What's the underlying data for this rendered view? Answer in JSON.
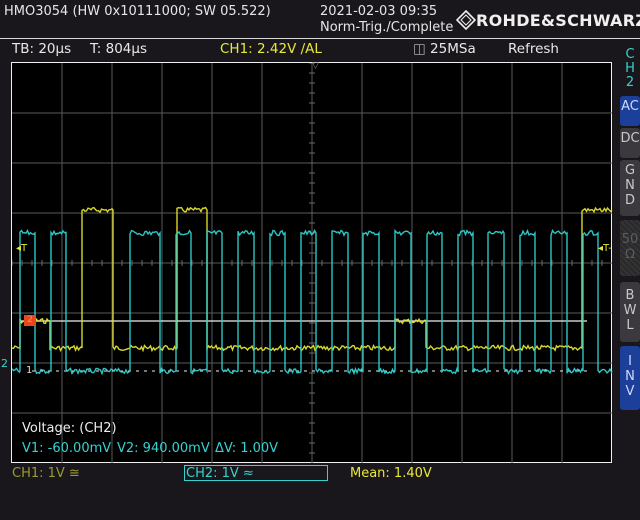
{
  "header": {
    "device": "HMO3054 (HW 0x10111000; SW 05.522)",
    "datetime": "2021-02-03 09:35",
    "trigger_state": "Norm-Trig./Complete",
    "brand": "ROHDE&SCHWARZ"
  },
  "status_bar": {
    "timebase": "TB: 20µs",
    "trigger_time": "T: 804µs",
    "trigger_level": "CH1: 2.42V ∕AL",
    "sample_rate": "25MSa",
    "mode": "Refresh"
  },
  "side_menu": {
    "channel": [
      "C",
      "H",
      "2"
    ],
    "buttons": [
      {
        "label": [
          "AC"
        ],
        "state": "on"
      },
      {
        "label": [
          "DC"
        ],
        "state": "off"
      },
      {
        "label": [
          "G",
          "N",
          "D"
        ],
        "state": "off"
      },
      {
        "label": [
          "50",
          "Ω"
        ],
        "state": "disabled"
      },
      {
        "label": [
          "B",
          "W",
          "L"
        ],
        "state": "off"
      },
      {
        "label": [
          "I",
          "N",
          "V"
        ],
        "state": "on"
      }
    ]
  },
  "markers": {
    "trigger_left": "◂T",
    "trigger_right": "◂T-",
    "ch1_ref": "1",
    "ch2_ref": "2",
    "ch2_marker": "2"
  },
  "measurement": {
    "title": "Voltage: (CH2)",
    "v1": "V1: -60.00mV",
    "v2": "V2: 940.00mV",
    "dv": "ΔV: 1.00V"
  },
  "footer": {
    "ch1": "CH1: 1V ≅",
    "ch2": "CH2: 1V ≈",
    "mean": "Mean: 1.40V"
  },
  "colors": {
    "ch1": "#e3e32e",
    "ch2": "#2fd0d0",
    "grid": "#5a5a5a"
  },
  "chart_data": {
    "type": "line",
    "x_unit": "µs",
    "y_unit": "div",
    "xlim": [
      0,
      240
    ],
    "ylim": [
      -4,
      4
    ],
    "grid": true,
    "series": [
      {
        "name": "CH2",
        "levels": {
          "L": -2.16,
          "H": 0.6
        },
        "edges": [
          0,
          3.2,
          9.2,
          15.6,
          21.6,
          47.2,
          59.2,
          65.6,
          71.6,
          78,
          84,
          90.4,
          96.8,
          103.2,
          109.2,
          115.6,
          121.6,
          128,
          134.4,
          140.4,
          146.8,
          153.2,
          159.6,
          166,
          172,
          178.4,
          184.4,
          190.4,
          196.8,
          203.2,
          209.2,
          215.6,
          222,
          228.4,
          234.4,
          240
        ],
        "states": [
          "L",
          "H",
          "L",
          "H",
          "L",
          "H",
          "L",
          "H",
          "L",
          "H",
          "L",
          "H",
          "L",
          "H",
          "L",
          "H",
          "L",
          "H",
          "L",
          "H",
          "L",
          "H",
          "L",
          "H",
          "L",
          "H",
          "L",
          "H",
          "L",
          "H",
          "L",
          "H",
          "L",
          "H",
          "L"
        ]
      },
      {
        "name": "CH1",
        "levels": {
          "L": -1.7,
          "M": -1.16,
          "H": 1.06
        },
        "edges": [
          0,
          3.2,
          15.2,
          28,
          40.4,
          66,
          78,
          153.2,
          165.6,
          228,
          240
        ],
        "states": [
          "L",
          "M",
          "L",
          "H",
          "L",
          "H",
          "L",
          "M",
          "L",
          "H"
        ]
      }
    ],
    "trigger_level_div": -1.16,
    "ch1_ref_div": -2.16
  }
}
